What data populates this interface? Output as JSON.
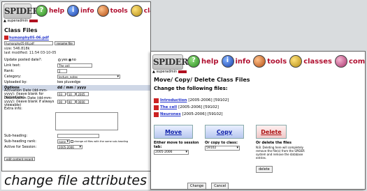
{
  "brand": "SPIDER",
  "user": "superadmin",
  "nav": [
    {
      "label": "help",
      "icon": "help-icon"
    },
    {
      "label": "info",
      "icon": "info-icon"
    },
    {
      "label": "tools",
      "icon": "tools-icon"
    },
    {
      "label": "classes",
      "icon": "classes-icon"
    },
    {
      "label": "comms",
      "icon": "comms-icon"
    }
  ],
  "left": {
    "title": "Class Files",
    "file_link": "humanphy05-06.pdf",
    "file_input": "humanphy05-06.pdf",
    "rename_btn": "rename file",
    "size": "size: 546.818k",
    "last_modified": "last modified: 11:54 03-10-05",
    "form": {
      "update_label": "Update posted date?:",
      "yes": "yes",
      "no": "no",
      "link_label": "Link text:",
      "link_value": "The cell",
      "rank_label": "Rank:",
      "rank_value": "2",
      "category_label": "Category:",
      "category_value": "lecture_notes",
      "uploaded_label": "Uploaded by:",
      "uploaded_value": "kes pluvedge",
      "options_label": "Options",
      "options_value": "dd / mm / yyyy",
      "activation_label": "Activation Date (dd-mm-yyyy): (leave blank for immediate)",
      "act_d": "03",
      "act_m": "10",
      "act_y": "2005",
      "deactivation_label": "Deactivation Date (dd-mm-yyyy): (leave blank if always viewable)",
      "deact_d": "00",
      "deact_m": "00",
      "deact_y": "0000",
      "extra_label": "Extra info:",
      "subheading_label": "Sub-heading:",
      "subrank_label": "Sub-heading rank:",
      "subrank_value": "none",
      "change_all": "change all files with the same sub-heading",
      "session_label": "Active for Session:",
      "session_value": "2005-2006",
      "edit_btn": "edit content record"
    }
  },
  "caption": "change file attributes",
  "right": {
    "title": "Move/ Copy/ Delete Class Files",
    "subtitle": "Change the following files:",
    "files": [
      {
        "name": "Introduction",
        "meta": "[2005-2006] [59102]"
      },
      {
        "name": "The cell",
        "meta": "[2005-2006] [59102]"
      },
      {
        "name": "Neurones",
        "meta": "[2005-2006] [59102]"
      }
    ],
    "move_label": "Move",
    "copy_label": "Copy",
    "delete_label": "Delete",
    "move_to": "Either move to session tab:",
    "move_value": "2005-2006",
    "copy_to": "Or copy to class:",
    "copy_value": "59102",
    "delete_title": "Or delete the files",
    "delete_note": "N.B. Deleting here will completely remove the file(s) from the SPIDER system and remove the database entries.",
    "change_btn": "Change",
    "cancel_btn": "Cancel",
    "delete_btn": "delete"
  }
}
